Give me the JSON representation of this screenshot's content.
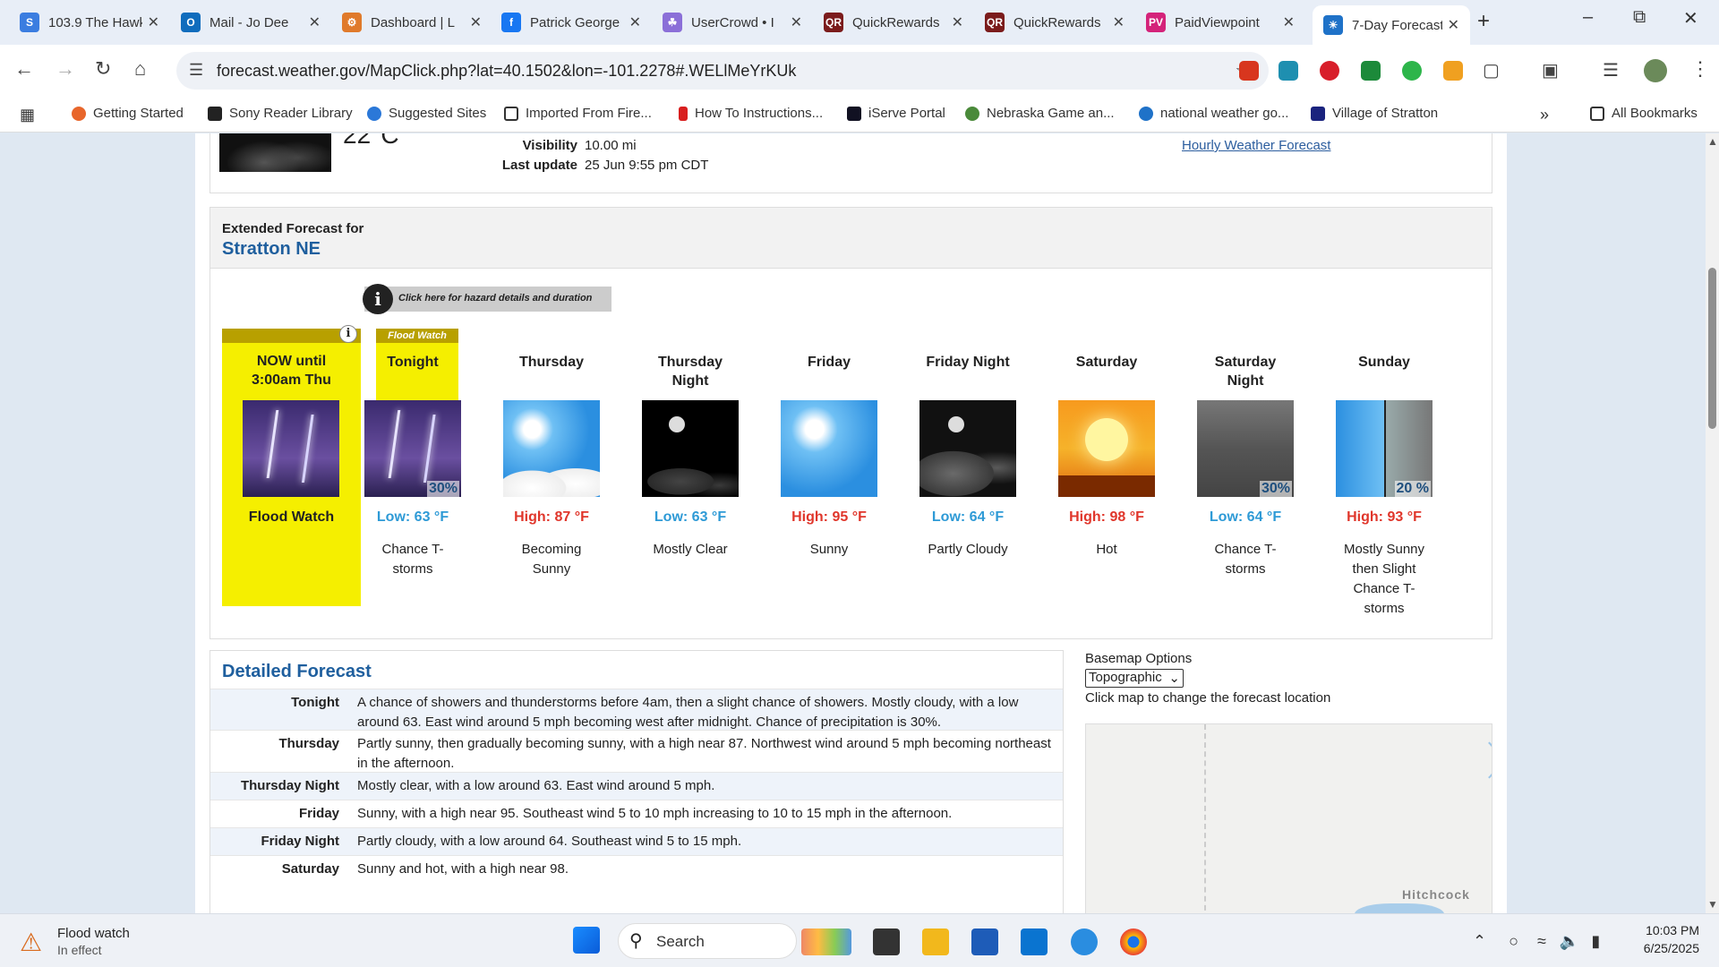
{
  "browser": {
    "tabs": [
      {
        "label": "103.9 The Hawk",
        "fav": "S",
        "color": "#3b7de0"
      },
      {
        "label": "Mail - Jo Dee",
        "fav": "O",
        "color": "#0f6cbd"
      },
      {
        "label": "Dashboard | L",
        "fav": "⚙",
        "color": "#e07a2b"
      },
      {
        "label": "Patrick George",
        "fav": "f",
        "color": "#1877f2"
      },
      {
        "label": "UserCrowd • I",
        "fav": "☘",
        "color": "#8b6fd8"
      },
      {
        "label": "QuickRewards",
        "fav": "QR",
        "color": "#7b1c1c"
      },
      {
        "label": "QuickRewards",
        "fav": "QR",
        "color": "#7b1c1c"
      },
      {
        "label": "PaidViewpoint",
        "fav": "PV",
        "color": "#d4237a"
      },
      {
        "label": "7-Day Forecast",
        "fav": "☀",
        "color": "#1f72c8"
      }
    ],
    "url": "forecast.weather.gov/MapClick.php?lat=40.1502&lon=-101.2278#.WELlMeYrKUk",
    "bookmarks": [
      "Getting Started",
      "Sony Reader Library",
      "Suggested Sites",
      "Imported From Fire...",
      "How To Instructions...",
      "iServe Portal",
      "Nebraska Game an...",
      "national weather go...",
      "Village of Stratton"
    ],
    "all_bookmarks": "All Bookmarks"
  },
  "current": {
    "temp": "22°C",
    "visibility_label": "Visibility",
    "visibility": "10.00 mi",
    "update_label": "Last update",
    "update": "25 Jun 9:55 pm CDT",
    "hourly_link": "Hourly Weather Forecast"
  },
  "extended": {
    "header_small": "Extended Forecast for",
    "location": "Stratton NE",
    "hazard_link": "Click here for hazard details and duration",
    "now": {
      "line1": "NOW until",
      "line2": "3:00am Thu",
      "label": "Flood Watch"
    },
    "watch_label": "Flood Watch",
    "periods": [
      {
        "name": "Tonight",
        "temp": "Low: 63 °F",
        "kind": "low",
        "desc": "Chance T-storms",
        "pop": "30%",
        "img": "storm"
      },
      {
        "name": "Thursday",
        "temp": "High: 87 °F",
        "kind": "high",
        "desc": "Becoming Sunny",
        "pop": "",
        "img": "suncloud"
      },
      {
        "name": "Thursday Night",
        "temp": "Low: 63 °F",
        "kind": "low",
        "desc": "Mostly Clear",
        "pop": "",
        "img": "nclear"
      },
      {
        "name": "Friday",
        "temp": "High: 95 °F",
        "kind": "high",
        "desc": "Sunny",
        "pop": "",
        "img": "sunny"
      },
      {
        "name": "Friday Night",
        "temp": "Low: 64 °F",
        "kind": "low",
        "desc": "Partly Cloudy",
        "pop": "",
        "img": "npart"
      },
      {
        "name": "Saturday",
        "temp": "High: 98 °F",
        "kind": "high",
        "desc": "Hot",
        "pop": "",
        "img": "hot"
      },
      {
        "name": "Saturday Night",
        "temp": "Low: 64 °F",
        "kind": "low",
        "desc": "Chance T-storms",
        "pop": "30%",
        "img": "gstorm"
      },
      {
        "name": "Sunday",
        "temp": "High: 93 °F",
        "kind": "high",
        "desc": "Mostly Sunny then Slight Chance T-storms",
        "pop": "20 %",
        "img": "split"
      }
    ]
  },
  "detailed": {
    "title": "Detailed Forecast",
    "rows": [
      {
        "k": "Tonight",
        "v": "A chance of showers and thunderstorms before 4am, then a slight chance of showers. Mostly cloudy, with a low around 63. East wind around 5 mph becoming west after midnight. Chance of precipitation is 30%."
      },
      {
        "k": "Thursday",
        "v": "Partly sunny, then gradually becoming sunny, with a high near 87. Northwest wind around 5 mph becoming northeast in the afternoon."
      },
      {
        "k": "Thursday Night",
        "v": "Mostly clear, with a low around 63. East wind around 5 mph."
      },
      {
        "k": "Friday",
        "v": "Sunny, with a high near 95. Southeast wind 5 to 10 mph increasing to 10 to 15 mph in the afternoon."
      },
      {
        "k": "Friday Night",
        "v": "Partly cloudy, with a low around 64. Southeast wind 5 to 15 mph."
      },
      {
        "k": "Saturday",
        "v": "Sunny and hot, with a high near 98."
      }
    ]
  },
  "map": {
    "basemap_label": "Basemap Options",
    "basemap_value": "Topographic",
    "hint": "Click map to change the forecast location",
    "town": "Hitchcock"
  },
  "taskbar": {
    "alert_title": "Flood watch",
    "alert_sub": "In effect",
    "search": "Search",
    "time": "10:03 PM",
    "date": "6/25/2025"
  }
}
